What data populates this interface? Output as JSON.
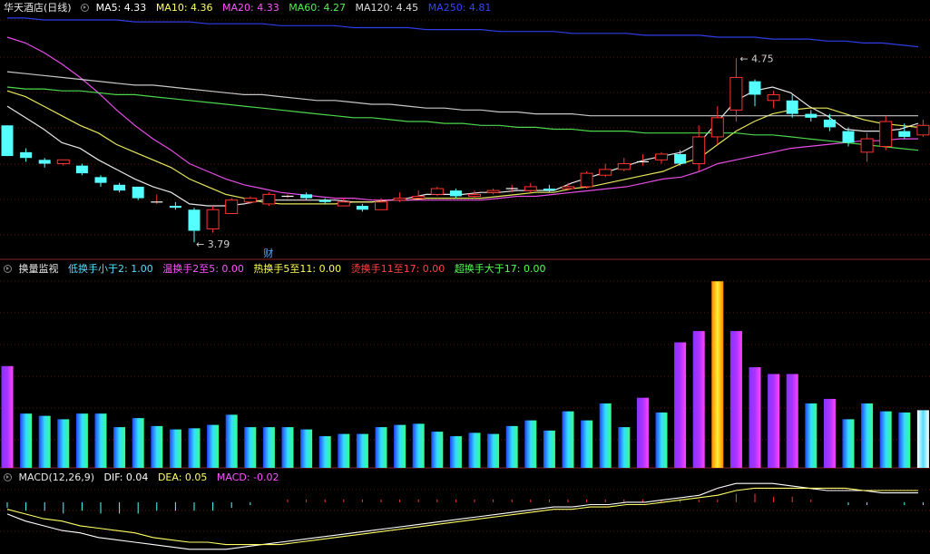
{
  "panels": {
    "main": {
      "title": "华天酒店(日线)",
      "ma": [
        {
          "label": "MA5: 4.33",
          "color": "#ffffff"
        },
        {
          "label": "MA10: 4.36",
          "color": "#ffff66"
        },
        {
          "label": "MA20: 4.33",
          "color": "#ff55ff"
        },
        {
          "label": "MA60: 4.27",
          "color": "#55ee55"
        },
        {
          "label": "MA120: 4.45",
          "color": "#dddddd"
        },
        {
          "label": "MA250: 4.81",
          "color": "#3344ff"
        }
      ],
      "high_label": "4.75",
      "low_label": "3.79",
      "marker": "财"
    },
    "volume": {
      "title": "换量监视",
      "items": [
        {
          "label": "低换手小于2: 1.00",
          "color": "#55ddff"
        },
        {
          "label": "温换手2至5: 0.00",
          "color": "#ff55ff"
        },
        {
          "label": "热换手5至11: 0.00",
          "color": "#ffff55"
        },
        {
          "label": "烫换手11至17: 0.00",
          "color": "#ff4444"
        },
        {
          "label": "超换手大于17: 0.00",
          "color": "#55ff55"
        }
      ]
    },
    "macd": {
      "title": "MACD(12,26,9)",
      "items": [
        {
          "label": "DIF: 0.04",
          "color": "#ffffff"
        },
        {
          "label": "DEA: 0.05",
          "color": "#ffff66"
        },
        {
          "label": "MACD: -0.02",
          "color": "#ff55ff"
        }
      ]
    }
  },
  "chart_data": [
    {
      "type": "candlestick",
      "title": "华天酒店(日线)",
      "ylim": [
        3.72,
        4.95
      ],
      "high": 4.75,
      "low": 3.79,
      "candles": [
        [
          4.4,
          4.24,
          4.4,
          4.24
        ],
        [
          4.26,
          4.23,
          4.28,
          4.21
        ],
        [
          4.22,
          4.2,
          4.23,
          4.18
        ],
        [
          4.2,
          4.22,
          4.22,
          4.19
        ],
        [
          4.19,
          4.15,
          4.2,
          4.14
        ],
        [
          4.13,
          4.1,
          4.14,
          4.08
        ],
        [
          4.09,
          4.06,
          4.1,
          4.05
        ],
        [
          4.08,
          4.02,
          4.08,
          4.01
        ],
        [
          4.0,
          4.0,
          4.04,
          3.99
        ],
        [
          3.98,
          3.97,
          4.0,
          3.96
        ],
        [
          3.96,
          3.85,
          3.97,
          3.79
        ],
        [
          3.86,
          3.96,
          3.98,
          3.84
        ],
        [
          3.94,
          4.01,
          4.02,
          3.94
        ],
        [
          4.0,
          4.02,
          4.03,
          3.99
        ],
        [
          3.99,
          4.04,
          4.05,
          3.98
        ],
        [
          4.03,
          4.03,
          4.04,
          4.02
        ],
        [
          4.04,
          4.02,
          4.05,
          4.01
        ],
        [
          4.01,
          4.0,
          4.02,
          3.99
        ],
        [
          3.98,
          4.0,
          4.02,
          3.98
        ],
        [
          3.98,
          3.96,
          3.99,
          3.95
        ],
        [
          3.96,
          4.0,
          4.02,
          3.96
        ],
        [
          4.01,
          4.02,
          4.05,
          4.0
        ],
        [
          4.02,
          4.03,
          4.06,
          4.02
        ],
        [
          4.04,
          4.07,
          4.08,
          4.03
        ],
        [
          4.06,
          4.03,
          4.07,
          4.02
        ],
        [
          4.03,
          4.04,
          4.06,
          4.02
        ],
        [
          4.05,
          4.06,
          4.07,
          4.04
        ],
        [
          4.07,
          4.07,
          4.09,
          4.05
        ],
        [
          4.06,
          4.08,
          4.1,
          4.05
        ],
        [
          4.07,
          4.06,
          4.09,
          4.05
        ],
        [
          4.07,
          4.08,
          4.1,
          4.06
        ],
        [
          4.08,
          4.15,
          4.16,
          4.07
        ],
        [
          4.14,
          4.17,
          4.2,
          4.13
        ],
        [
          4.17,
          4.2,
          4.23,
          4.16
        ],
        [
          4.21,
          4.21,
          4.25,
          4.19
        ],
        [
          4.22,
          4.25,
          4.26,
          4.2
        ],
        [
          4.25,
          4.2,
          4.27,
          4.19
        ],
        [
          4.2,
          4.34,
          4.4,
          4.16
        ],
        [
          4.34,
          4.44,
          4.5,
          4.3
        ],
        [
          4.48,
          4.65,
          4.75,
          4.42
        ],
        [
          4.63,
          4.56,
          4.64,
          4.5
        ],
        [
          4.53,
          4.56,
          4.58,
          4.49
        ],
        [
          4.53,
          4.46,
          4.56,
          4.44
        ],
        [
          4.46,
          4.44,
          4.48,
          4.42
        ],
        [
          4.43,
          4.39,
          4.46,
          4.37
        ],
        [
          4.37,
          4.31,
          4.39,
          4.29
        ],
        [
          4.26,
          4.33,
          4.36,
          4.21
        ],
        [
          4.29,
          4.42,
          4.45,
          4.27
        ],
        [
          4.37,
          4.34,
          4.41,
          4.33
        ],
        [
          4.35,
          4.4,
          4.43,
          4.34
        ],
        [
          4.39,
          4.38,
          4.44,
          4.35
        ]
      ],
      "series": [
        {
          "name": "MA5",
          "values": [
            4.5,
            4.44,
            4.38,
            4.31,
            4.28,
            4.22,
            4.17,
            4.12,
            4.08,
            4.05,
            3.99,
            3.98,
            3.98,
            3.99,
            4.01,
            4.01,
            4.01,
            4.01,
            4.01,
            4.0,
            4.0,
            4.01,
            4.02,
            4.04,
            4.04,
            4.04,
            4.05,
            4.05,
            4.06,
            4.06,
            4.06,
            4.1,
            4.13,
            4.16,
            4.19,
            4.22,
            4.24,
            4.26,
            4.31,
            4.42,
            4.53,
            4.58,
            4.6,
            4.57,
            4.5,
            4.45,
            4.38,
            4.37,
            4.37,
            4.38,
            4.41
          ]
        },
        {
          "name": "MA10",
          "values": [
            4.58,
            4.55,
            4.5,
            4.45,
            4.4,
            4.36,
            4.3,
            4.26,
            4.22,
            4.18,
            4.12,
            4.08,
            4.04,
            4.02,
            4.0,
            3.99,
            3.99,
            3.99,
            3.99,
            4.0,
            4.0,
            4.01,
            4.01,
            4.02,
            4.02,
            4.02,
            4.02,
            4.03,
            4.04,
            4.05,
            4.05,
            4.07,
            4.08,
            4.1,
            4.12,
            4.14,
            4.16,
            4.2,
            4.23,
            4.3,
            4.37,
            4.42,
            4.46,
            4.48,
            4.49,
            4.49,
            4.46,
            4.43,
            4.41,
            4.4,
            4.39
          ]
        },
        {
          "name": "MA20",
          "values": [
            4.86,
            4.83,
            4.78,
            4.72,
            4.65,
            4.57,
            4.48,
            4.4,
            4.33,
            4.27,
            4.2,
            4.16,
            4.12,
            4.09,
            4.07,
            4.05,
            4.04,
            4.03,
            4.02,
            4.02,
            4.01,
            4.01,
            4.01,
            4.01,
            4.01,
            4.01,
            4.01,
            4.02,
            4.03,
            4.03,
            4.04,
            4.05,
            4.06,
            4.07,
            4.08,
            4.1,
            4.12,
            4.13,
            4.16,
            4.2,
            4.22,
            4.24,
            4.26,
            4.28,
            4.29,
            4.3,
            4.31,
            4.32,
            4.32,
            4.33,
            4.33
          ]
        },
        {
          "name": "MA60",
          "values": [
            4.6,
            4.59,
            4.59,
            4.58,
            4.58,
            4.57,
            4.56,
            4.56,
            4.55,
            4.54,
            4.53,
            4.52,
            4.51,
            4.5,
            4.49,
            4.48,
            4.47,
            4.46,
            4.45,
            4.44,
            4.44,
            4.43,
            4.42,
            4.42,
            4.41,
            4.41,
            4.4,
            4.4,
            4.39,
            4.39,
            4.38,
            4.38,
            4.37,
            4.37,
            4.37,
            4.36,
            4.36,
            4.36,
            4.36,
            4.36,
            4.36,
            4.35,
            4.35,
            4.34,
            4.33,
            4.32,
            4.31,
            4.3,
            4.29,
            4.28,
            4.27
          ]
        },
        {
          "name": "MA120",
          "values": [
            4.68,
            4.67,
            4.66,
            4.65,
            4.64,
            4.63,
            4.62,
            4.61,
            4.61,
            4.6,
            4.59,
            4.58,
            4.57,
            4.56,
            4.56,
            4.55,
            4.54,
            4.53,
            4.53,
            4.52,
            4.51,
            4.51,
            4.5,
            4.49,
            4.49,
            4.48,
            4.48,
            4.47,
            4.47,
            4.46,
            4.46,
            4.46,
            4.45,
            4.45,
            4.45,
            4.45,
            4.45,
            4.45,
            4.45,
            4.45,
            4.45,
            4.45,
            4.45,
            4.45,
            4.45,
            4.45,
            4.45,
            4.45,
            4.45,
            4.45,
            4.45
          ]
        },
        {
          "name": "MA250",
          "values": [
            4.96,
            4.96,
            4.95,
            4.95,
            4.95,
            4.95,
            4.95,
            4.94,
            4.94,
            4.94,
            4.94,
            4.93,
            4.93,
            4.93,
            4.93,
            4.92,
            4.92,
            4.92,
            4.92,
            4.91,
            4.91,
            4.91,
            4.91,
            4.9,
            4.9,
            4.9,
            4.9,
            4.89,
            4.89,
            4.89,
            4.89,
            4.88,
            4.88,
            4.88,
            4.88,
            4.87,
            4.87,
            4.87,
            4.87,
            4.86,
            4.86,
            4.86,
            4.85,
            4.85,
            4.85,
            4.84,
            4.84,
            4.83,
            4.83,
            4.82,
            4.81
          ]
        }
      ]
    },
    {
      "type": "bar",
      "title": "换量监视",
      "ylim": [
        0,
        1.7
      ],
      "values": [
        0.9,
        0.48,
        0.46,
        0.43,
        0.48,
        0.48,
        0.36,
        0.44,
        0.37,
        0.34,
        0.35,
        0.38,
        0.47,
        0.36,
        0.36,
        0.36,
        0.34,
        0.28,
        0.3,
        0.3,
        0.36,
        0.38,
        0.39,
        0.32,
        0.28,
        0.31,
        0.3,
        0.37,
        0.42,
        0.33,
        0.5,
        0.42,
        0.57,
        0.36,
        0.62,
        0.49,
        1.11,
        1.21,
        1.65,
        1.21,
        0.89,
        0.83,
        0.83,
        0.57,
        0.61,
        0.43,
        0.57,
        0.5,
        0.49,
        0.51
      ],
      "categories_by_bar": [
        "超",
        "低",
        "低",
        "低",
        "低",
        "低",
        "低",
        "低",
        "低",
        "低",
        "低",
        "低",
        "低",
        "低",
        "低",
        "低",
        "低",
        "低",
        "低",
        "低",
        "低",
        "低",
        "低",
        "低",
        "低",
        "低",
        "低",
        "低",
        "低",
        "低",
        "低",
        "低",
        "低",
        "低",
        "超",
        "低",
        "超",
        "超",
        "热",
        "超",
        "超",
        "超",
        "超",
        "低",
        "超",
        "低",
        "低",
        "低",
        "低",
        "白"
      ]
    },
    {
      "type": "line",
      "title": "MACD(12,26,9)",
      "ylim": [
        -0.22,
        0.1
      ],
      "series": [
        {
          "name": "DIF",
          "values": [
            -0.05,
            -0.08,
            -0.1,
            -0.12,
            -0.13,
            -0.15,
            -0.16,
            -0.17,
            -0.18,
            -0.19,
            -0.2,
            -0.2,
            -0.2,
            -0.19,
            -0.18,
            -0.17,
            -0.16,
            -0.15,
            -0.14,
            -0.13,
            -0.12,
            -0.11,
            -0.1,
            -0.09,
            -0.08,
            -0.07,
            -0.06,
            -0.05,
            -0.04,
            -0.03,
            -0.02,
            -0.02,
            -0.01,
            -0.01,
            0.0,
            0.0,
            0.01,
            0.02,
            0.03,
            0.06,
            0.08,
            0.08,
            0.08,
            0.07,
            0.06,
            0.05,
            0.05,
            0.05,
            0.04,
            0.04,
            0.04
          ]
        },
        {
          "name": "DEA",
          "values": [
            -0.03,
            -0.05,
            -0.07,
            -0.08,
            -0.1,
            -0.11,
            -0.12,
            -0.13,
            -0.15,
            -0.16,
            -0.17,
            -0.17,
            -0.18,
            -0.18,
            -0.18,
            -0.18,
            -0.17,
            -0.16,
            -0.15,
            -0.14,
            -0.13,
            -0.12,
            -0.11,
            -0.1,
            -0.09,
            -0.08,
            -0.07,
            -0.06,
            -0.05,
            -0.04,
            -0.03,
            -0.03,
            -0.02,
            -0.02,
            -0.01,
            -0.01,
            0.0,
            0.01,
            0.02,
            0.03,
            0.05,
            0.06,
            0.06,
            0.06,
            0.06,
            0.06,
            0.06,
            0.05,
            0.05,
            0.05,
            0.05
          ]
        },
        {
          "name": "MACD",
          "values": [
            -0.04,
            -0.06,
            -0.06,
            -0.08,
            -0.06,
            -0.08,
            -0.08,
            -0.08,
            -0.06,
            -0.06,
            -0.06,
            -0.06,
            -0.04,
            -0.02,
            0.0,
            0.02,
            0.02,
            0.02,
            0.02,
            0.02,
            0.02,
            0.02,
            0.02,
            0.02,
            0.02,
            0.02,
            0.02,
            0.02,
            0.02,
            0.02,
            0.02,
            0.02,
            0.02,
            0.02,
            0.02,
            0.02,
            0.02,
            0.02,
            0.02,
            0.06,
            0.06,
            0.04,
            0.04,
            0.02,
            0.0,
            -0.02,
            -0.02,
            0.0,
            -0.02,
            -0.02,
            -0.02
          ]
        }
      ]
    }
  ]
}
